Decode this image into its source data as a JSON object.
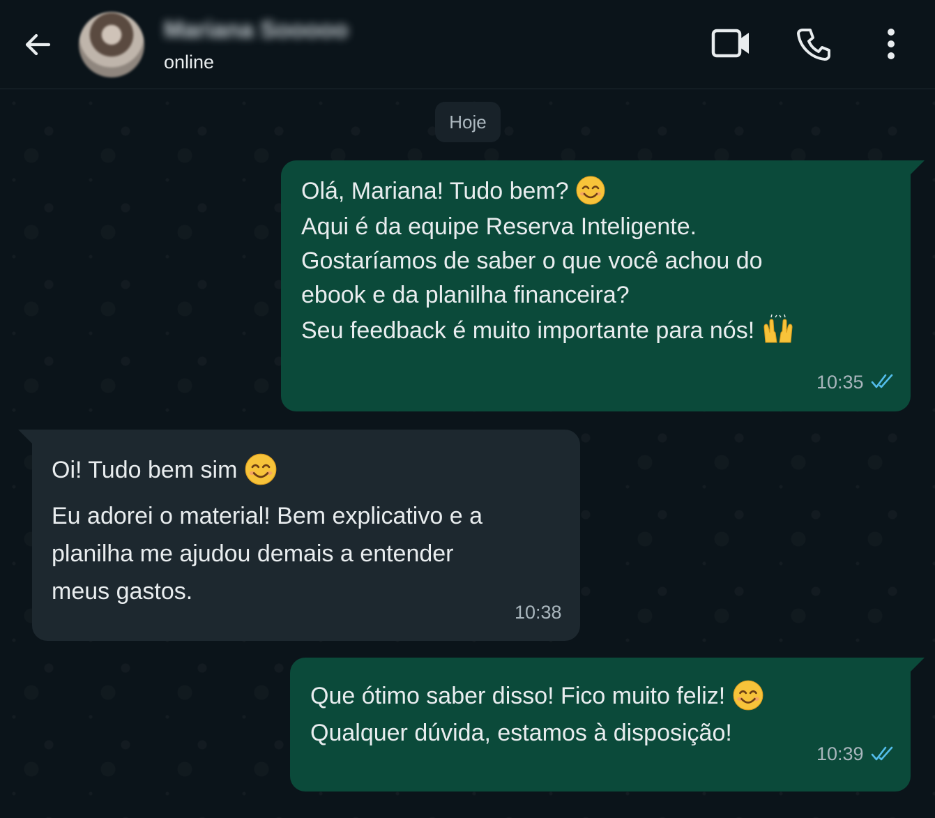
{
  "header": {
    "contact_name": "Mariana Sooooo",
    "status": "online"
  },
  "chat": {
    "date_label": "Hoje",
    "messages": [
      {
        "direction": "outgoing",
        "lines": [
          "Olá, Mariana! Tudo bem?",
          "Aqui é da equipe Reserva Inteligente.",
          "Gostaríamos de saber o que você achou do",
          "ebook e da planilha financeira?",
          "Seu feedback é muito importante para nós!"
        ],
        "emojis": [
          "smiling-face-emoji",
          "raising-hands-emoji"
        ],
        "time": "10:35",
        "status": "read"
      },
      {
        "direction": "incoming",
        "lines": [
          "Oi! Tudo bem sim",
          "Eu adorei o material! Bem explicativo e a",
          "planilha me ajudou demais a entender",
          "meus gastos."
        ],
        "emojis": [
          "smiling-face-emoji"
        ],
        "time": "10:38"
      },
      {
        "direction": "outgoing",
        "lines": [
          "Que ótimo saber disso! Fico muito feliz!",
          "Qualquer dúvida, estamos à disposição!"
        ],
        "emojis": [
          "smiling-face-emoji"
        ],
        "time": "10:39",
        "status": "read"
      }
    ]
  },
  "icons": {
    "back": "arrow-left-icon",
    "video": "video-camera-icon",
    "call": "phone-icon",
    "menu": "more-vertical-icon",
    "read_receipt": "double-check-icon"
  },
  "colors": {
    "background": "#0b141a",
    "outgoing_bubble": "#0b4a3a",
    "incoming_bubble": "#1d282f",
    "read_ticks": "#53bdeb",
    "text": "#e9edef"
  }
}
